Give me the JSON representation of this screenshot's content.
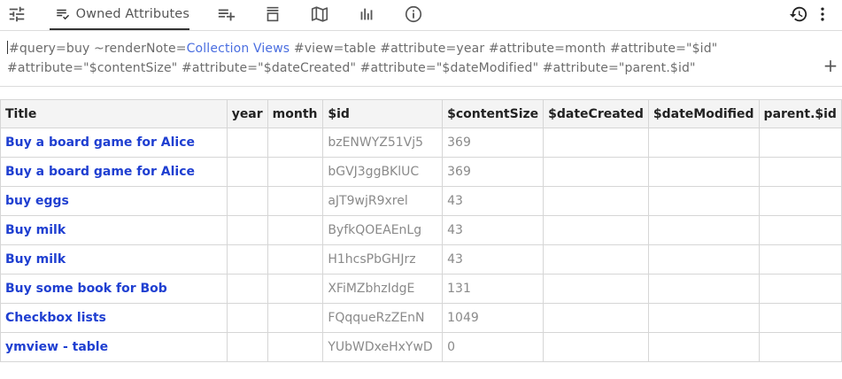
{
  "toolbar": {
    "owned_attributes_tab": "Owned Attributes",
    "icons": [
      "sliders-icon",
      "owned-attributes-icon",
      "add-list-icon",
      "collapse-icon",
      "map-icon",
      "bar-chart-icon",
      "info-icon",
      "history-icon",
      "more-vert-icon"
    ]
  },
  "attribute_editor": {
    "part1": "#query=buy ~renderNote=",
    "link": "Collection Views",
    "part2": " #view=table #attribute=year #attribute=month #attribute=\"$id\"",
    "line2": "#attribute=\"$contentSize\" #attribute=\"$dateCreated\" #attribute=\"$dateModified\" #attribute=\"parent.$id\"",
    "add_button": "+"
  },
  "table": {
    "columns": [
      "Title",
      "year",
      "month",
      "$id",
      "$contentSize",
      "$dateCreated",
      "$dateModified",
      "parent.$id"
    ],
    "rows": [
      {
        "title": "Buy a board game for Alice",
        "year": "",
        "month": "",
        "id": "bzENWYZ51Vj5",
        "contentSize": "369",
        "dateCreated": "",
        "dateModified": "",
        "parentId": ""
      },
      {
        "title": "Buy a board game for Alice",
        "year": "",
        "month": "",
        "id": "bGVJ3ggBKlUC",
        "contentSize": "369",
        "dateCreated": "",
        "dateModified": "",
        "parentId": ""
      },
      {
        "title": "buy eggs",
        "year": "",
        "month": "",
        "id": "aJT9wjR9xrel",
        "contentSize": "43",
        "dateCreated": "",
        "dateModified": "",
        "parentId": ""
      },
      {
        "title": "Buy milk",
        "year": "",
        "month": "",
        "id": "ByfkQOEAEnLg",
        "contentSize": "43",
        "dateCreated": "",
        "dateModified": "",
        "parentId": ""
      },
      {
        "title": "Buy milk",
        "year": "",
        "month": "",
        "id": "H1hcsPbGHJrz",
        "contentSize": "43",
        "dateCreated": "",
        "dateModified": "",
        "parentId": ""
      },
      {
        "title": "Buy some book for Bob",
        "year": "",
        "month": "",
        "id": "XFiMZbhzIdgE",
        "contentSize": "131",
        "dateCreated": "",
        "dateModified": "",
        "parentId": ""
      },
      {
        "title": "Checkbox lists",
        "year": "",
        "month": "",
        "id": "FQqqueRzZEnN",
        "contentSize": "1049",
        "dateCreated": "",
        "dateModified": "",
        "parentId": ""
      },
      {
        "title": "ymview - table",
        "year": "",
        "month": "",
        "id": "YUbWDxeHxYwD",
        "contentSize": "0",
        "dateCreated": "",
        "dateModified": "",
        "parentId": ""
      }
    ]
  }
}
